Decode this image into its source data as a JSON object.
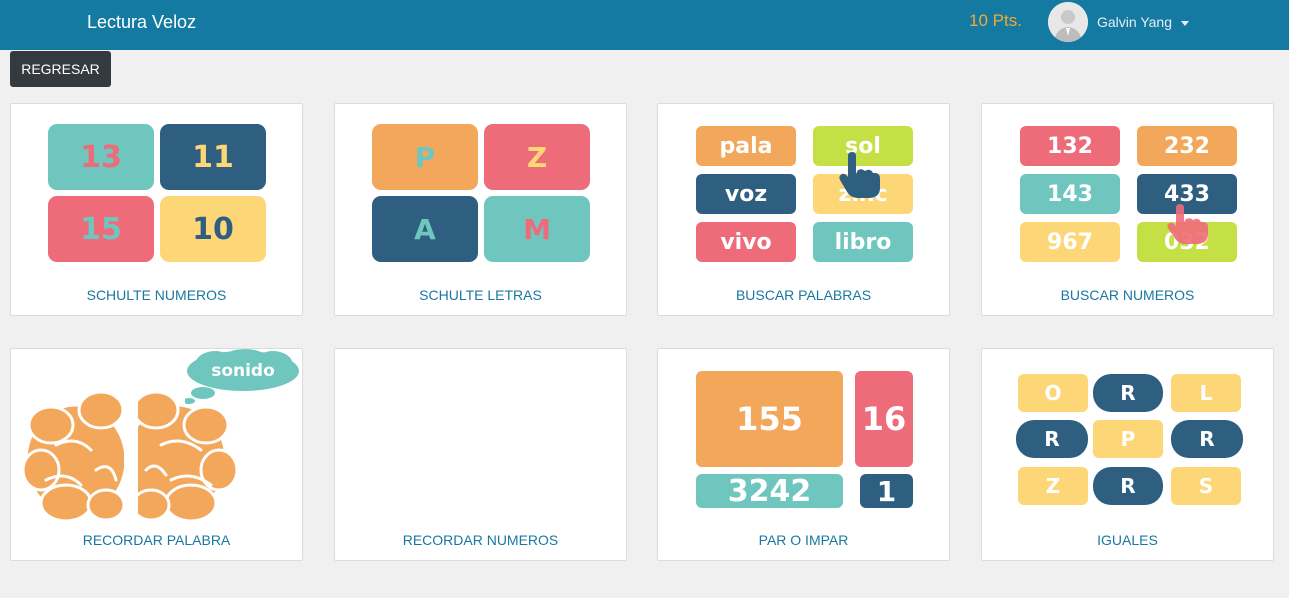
{
  "header": {
    "brand": "Lectura Veloz",
    "points": "10 Pts.",
    "user_name": "Galvin Yang"
  },
  "back_button": "REGRESAR",
  "cards": [
    {
      "label": "SCHULTE NUMEROS",
      "tiles": [
        "13",
        "11",
        "15",
        "10"
      ]
    },
    {
      "label": "SCHULTE LETRAS",
      "tiles": [
        "P",
        "Z",
        "A",
        "M"
      ]
    },
    {
      "label": "BUSCAR PALABRAS",
      "tiles": [
        "pala",
        "sol",
        "voz",
        "zinc",
        "vivo",
        "libro"
      ]
    },
    {
      "label": "BUSCAR NUMEROS",
      "tiles": [
        "132",
        "232",
        "143",
        "433",
        "967",
        "032"
      ]
    },
    {
      "label": "RECORDAR PALABRA",
      "bubble": "sonido"
    },
    {
      "label": "RECORDAR NUMEROS"
    },
    {
      "label": "PAR O IMPAR",
      "tiles": [
        "155",
        "16",
        "3242",
        "1"
      ]
    },
    {
      "label": "IGUALES",
      "tiles": [
        "O",
        "R",
        "L",
        "R",
        "P",
        "R",
        "Z",
        "R",
        "S"
      ]
    }
  ],
  "colors": {
    "navbar": "#157aa1",
    "points": "#f0a93a",
    "label": "#1a77a0",
    "orange": "#f3a75a",
    "red": "#ee6b7a",
    "navy": "#2f5f80",
    "teal": "#6fc6bf",
    "yellow": "#fdd777",
    "lime": "#c5e045"
  },
  "icons": {
    "avatar": "user-avatar-silhouette",
    "hand": "pointing-hand-icon",
    "brain": "brain-icon",
    "cloud": "thought-cloud-icon"
  }
}
